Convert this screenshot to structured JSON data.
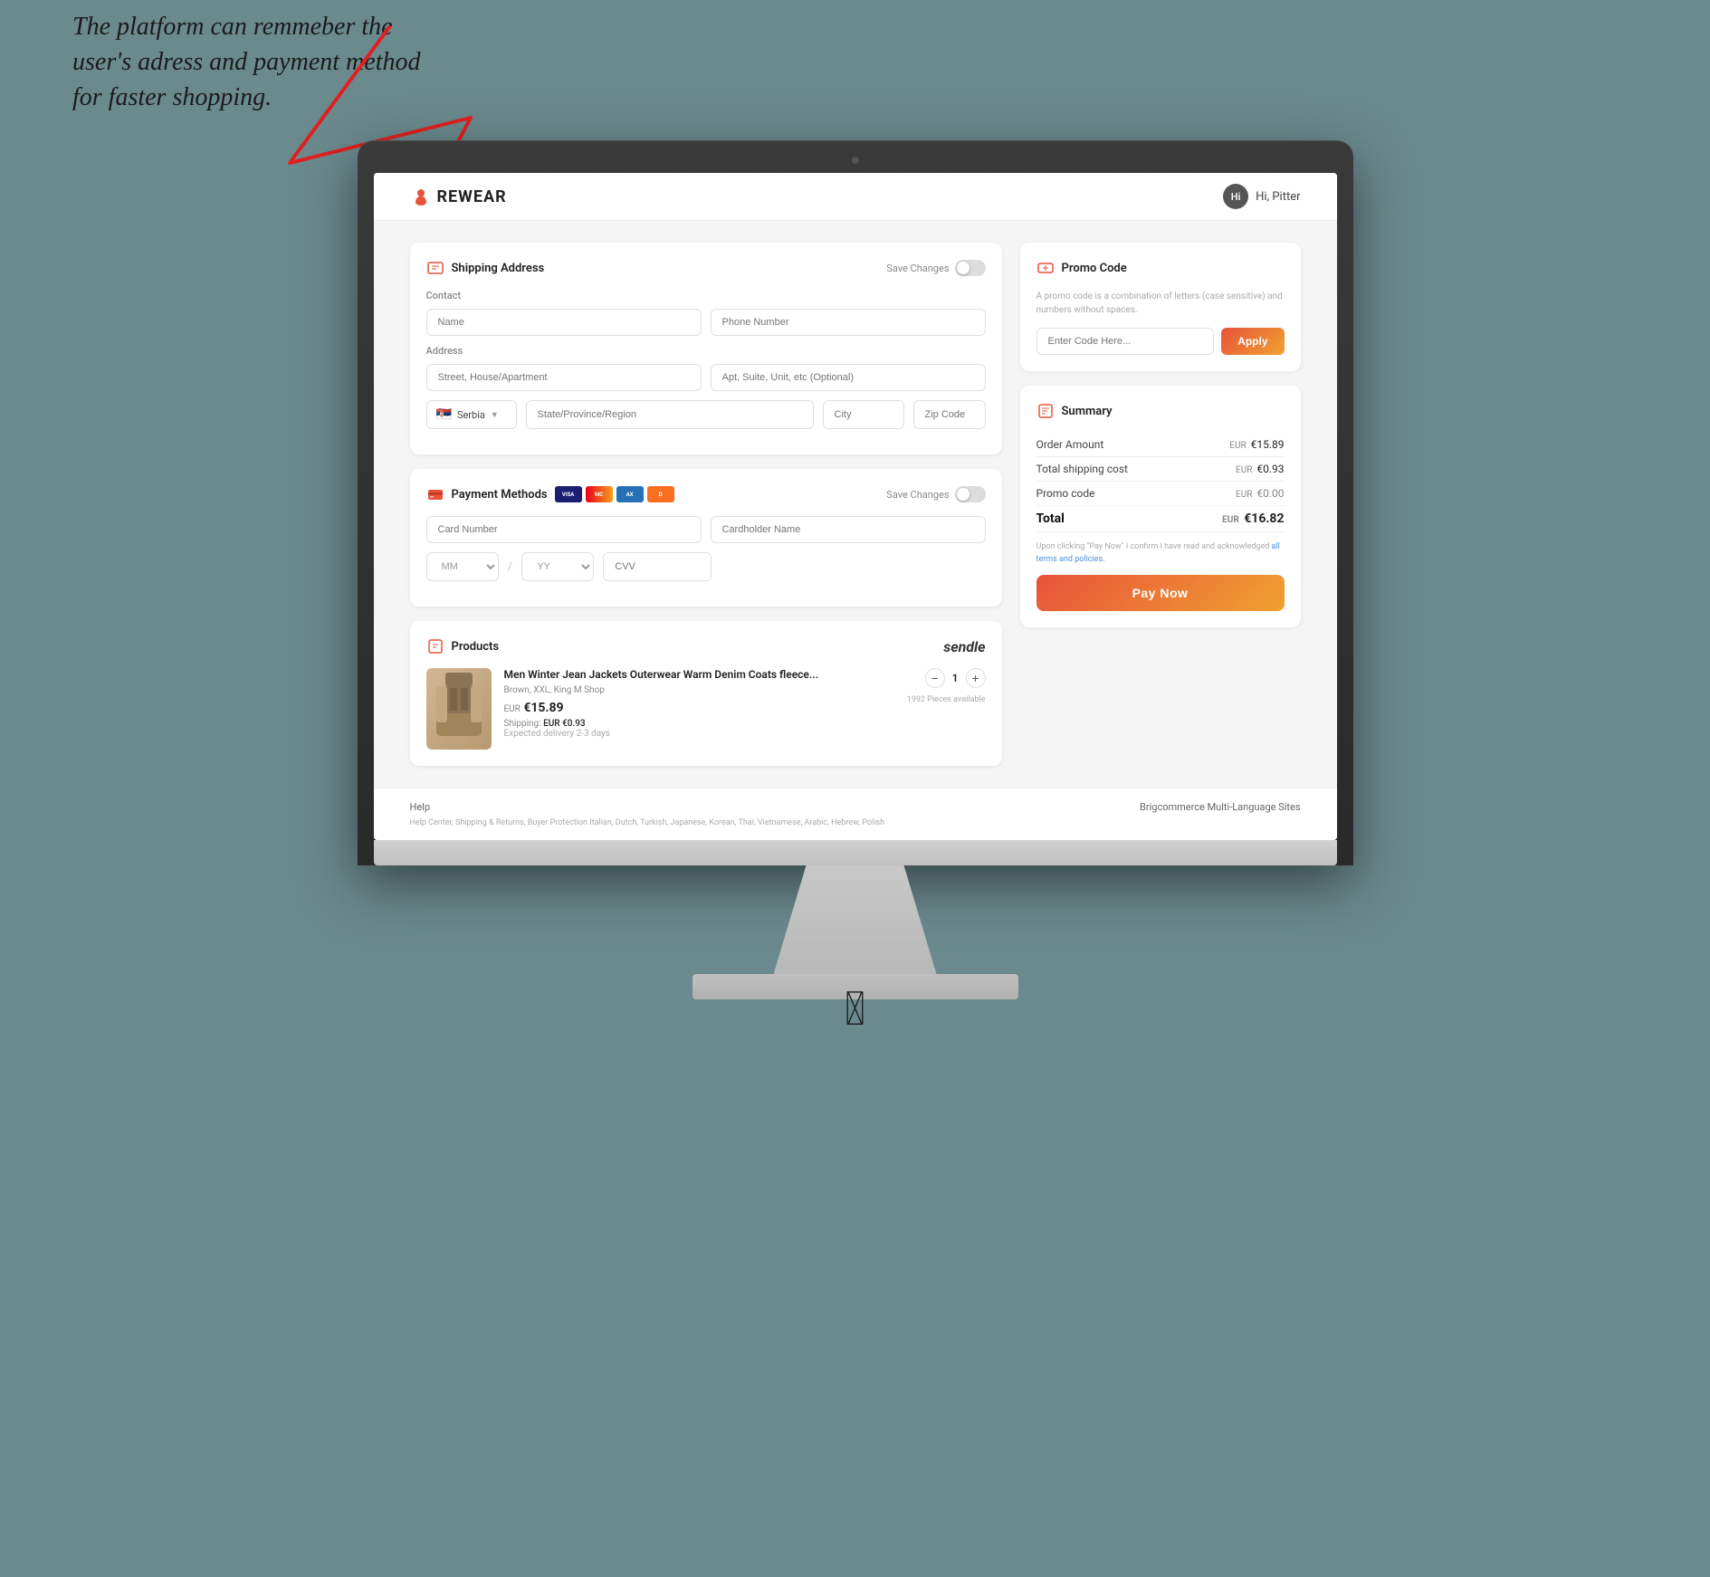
{
  "annotation": {
    "text": "The platform can remmeber the user's adress and payment method for faster shopping."
  },
  "header": {
    "logo_text": "REWEAR",
    "user_greeting": "Hi, Pitter"
  },
  "shipping": {
    "title": "Shipping Address",
    "save_changes": "Save Changes",
    "contact_label": "Contact",
    "name_placeholder": "Name",
    "phone_placeholder": "Phone Number",
    "address_label": "Address",
    "street_placeholder": "Street, House/Apartment",
    "apt_placeholder": "Apt, Suite, Unit, etc (Optional)",
    "country": "Serbia",
    "state_placeholder": "State/Province/Region",
    "city_placeholder": "City",
    "zip_placeholder": "Zip Code"
  },
  "payment": {
    "title": "Payment Methods",
    "save_changes": "Save Changes",
    "card_number_placeholder": "Card Number",
    "cardholder_placeholder": "Cardholder Name",
    "month_placeholder": "MM",
    "year_placeholder": "YY",
    "cvv_placeholder": "CVV"
  },
  "products": {
    "title": "Products",
    "item": {
      "name": "Men Winter Jean Jackets Outerwear Warm Denim Coats fleece...",
      "variant": "Brown, XXL, King M Shop",
      "price": "€15.89",
      "price_currency": "EUR",
      "shipping_cost": "EUR €0.93",
      "shipping_label": "Shipping:",
      "delivery": "Expected delivery 2-3 days",
      "quantity": "1",
      "pieces_available": "1992 Pieces available"
    }
  },
  "promo": {
    "title": "Promo Code",
    "description": "A promo code is a combination of letters (case sensitive) and numbers without spaces.",
    "input_placeholder": "Enter Code Here...",
    "apply_button": "Apply"
  },
  "summary": {
    "title": "Summary",
    "order_amount_label": "Order Amount",
    "order_amount_currency": "EUR",
    "order_amount_value": "€15.89",
    "shipping_label": "Total shipping cost",
    "shipping_currency": "EUR",
    "shipping_value": "€0.93",
    "promo_label": "Promo code",
    "promo_currency": "EUR",
    "promo_value": "€0.00",
    "total_label": "Total",
    "total_currency": "EUR",
    "total_value": "€16.82",
    "terms_text": "Upon clicking \"Pay Now\" I confirm I have read and acknowledged ",
    "terms_link": "all terms and policies.",
    "pay_now": "Pay Now"
  },
  "footer": {
    "help": "Help",
    "platform": "Brigcommerce Multi-Language Sites",
    "links": "Help Center, Shipping & Returns, Buyer Protection      Italian, Dutch, Turkish, Japanese, Korean, Thai, Vietnamese, Arabic, Hebrew, Polish"
  }
}
